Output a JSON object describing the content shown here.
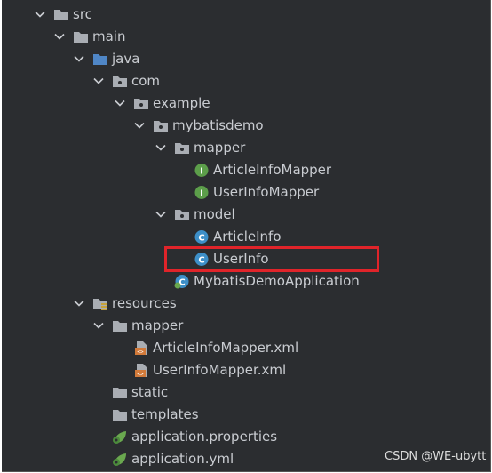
{
  "tree": {
    "items": [
      {
        "label": "src",
        "icon": "folder-icon",
        "expanded": true
      },
      {
        "label": "main",
        "icon": "folder-icon",
        "expanded": true
      },
      {
        "label": "java",
        "icon": "source-folder-icon",
        "expanded": true
      },
      {
        "label": "com",
        "icon": "package-icon",
        "expanded": true
      },
      {
        "label": "example",
        "icon": "package-icon",
        "expanded": true
      },
      {
        "label": "mybatisdemo",
        "icon": "package-icon",
        "expanded": true
      },
      {
        "label": "mapper",
        "icon": "package-icon",
        "expanded": true
      },
      {
        "label": "ArticleInfoMapper",
        "icon": "interface-icon"
      },
      {
        "label": "UserInfoMapper",
        "icon": "interface-icon"
      },
      {
        "label": "model",
        "icon": "package-icon",
        "expanded": true
      },
      {
        "label": "ArticleInfo",
        "icon": "class-icon"
      },
      {
        "label": "UserInfo",
        "icon": "class-icon",
        "highlighted": true
      },
      {
        "label": "MybatisDemoApplication",
        "icon": "spring-boot-class-icon"
      },
      {
        "label": "resources",
        "icon": "resources-folder-icon",
        "expanded": true
      },
      {
        "label": "mapper",
        "icon": "folder-icon",
        "expanded": true
      },
      {
        "label": "ArticleInfoMapper.xml",
        "icon": "xml-file-icon"
      },
      {
        "label": "UserInfoMapper.xml",
        "icon": "xml-file-icon"
      },
      {
        "label": "static",
        "icon": "folder-icon"
      },
      {
        "label": "templates",
        "icon": "folder-icon"
      },
      {
        "label": "application.properties",
        "icon": "spring-config-icon"
      },
      {
        "label": "application.yml",
        "icon": "spring-config-icon"
      }
    ]
  },
  "watermark": "CSDN @WE-ubytt",
  "colors": {
    "background": "#2b2d30",
    "text": "#c9ccd1",
    "interface_icon": "#5c9e4a",
    "class_icon": "#3d8fc8",
    "xml_icon": "#d27a3a",
    "spring_icon": "#6aa84f",
    "highlight_border": "#e0242a"
  }
}
